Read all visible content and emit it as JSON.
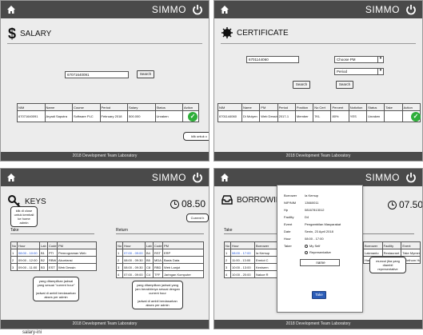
{
  "app": {
    "brand": "SIMMO",
    "footer": "2018 Development Team Laboratory"
  },
  "salary": {
    "title": "SALARY",
    "search_value": "67071640091",
    "search_button": "Search",
    "columns": [
      "NIM",
      "Name",
      "Course",
      "Period",
      "Salary",
      "Status",
      "Action"
    ],
    "row": [
      "67071640091",
      "Aryadi Saputra",
      "Software PLC",
      "February 2018",
      "500.000",
      "Unraken",
      ""
    ],
    "note": "klik untuk c"
  },
  "certificate": {
    "title": "CERTIFICATE",
    "search_value": "6701144060",
    "select_pm": "Choose PM",
    "select_period": "Period",
    "search_button_1": "Search",
    "search_button_2": "Search",
    "columns": [
      "NIM",
      "Name",
      "PM",
      "Period",
      "Position",
      "No Cert",
      "Percent",
      "Notiction",
      "Status",
      "Take",
      "Action"
    ],
    "row": [
      "6701144060",
      "Di Mulyen",
      "Web Dessin",
      "2017-1",
      "Member",
      "7KL",
      "80%",
      "YES",
      "Unraken",
      "",
      ""
    ]
  },
  "keys": {
    "title": "KEYS",
    "time": "08.50",
    "current_label": "Current h",
    "take_note": "klik di close untuk kembali ke home admin",
    "take_label": "Take",
    "return_label": "Return",
    "take_columns": [
      "No",
      "Hour",
      "Lab",
      "Code",
      "PM"
    ],
    "take_rows": [
      [
        "1",
        "08:00 - 10:00",
        "B1",
        "PTI",
        "Pemrograman Web"
      ],
      [
        "2",
        "09:00 - 12:00",
        "B2",
        "RBW",
        "Akuntansi"
      ],
      [
        "3",
        "09:00 - 11:00",
        "B3",
        "EST",
        "Web Dessin"
      ]
    ],
    "return_columns": [
      "No",
      "Hour",
      "Lab",
      "Code",
      "PM"
    ],
    "return_rows": [
      [
        "1",
        "07:00 - 09:00",
        "B4",
        "RST",
        "ERP"
      ],
      [
        "2",
        "08:00 - 09:30",
        "B5",
        "MDA",
        "Basis Data"
      ],
      [
        "3",
        "08:00 - 09:30",
        "C8",
        "RBD",
        "Web Lanjut"
      ],
      [
        "4",
        "07:00 - 09:00",
        "C4",
        "TFF",
        "Jaringan Komputer"
      ]
    ],
    "take_note_bottom": "yang ditampilkan jadwal yang sesuai \"current hour\"\n\njadwal di ambil berdasarkan akses per admin",
    "return_note_bottom": "yang ditampilkan jadwal yang jam berakhirnya sesuai dengan current hour\n\njadwal di ambil berdasarkan akses per admin"
  },
  "borrowing": {
    "title": "BORROWIN",
    "time": "07.50",
    "take_label": "Take",
    "columns_left": [
      "No",
      "Hour",
      "Borrower"
    ],
    "rows_left": [
      [
        "1",
        "08:00 - 17:00",
        "Ia Kemup"
      ],
      [
        "2",
        "11:00 - 13:00",
        "Ermiot C"
      ],
      [
        "3",
        "10:00 - 13:00",
        "Kenisem"
      ],
      [
        "4",
        "10:00 - 20:00",
        "Nakoe R"
      ]
    ],
    "columns_right": [
      "Borrower",
      "Facility",
      "Event"
    ],
    "rows_right": [
      [
        "Lakmanto",
        "Restaurant",
        "Take Mymer"
      ],
      [
        "Hardy S",
        "Gallery",
        "Pelethom Hotel"
      ]
    ],
    "modal": {
      "fields": [
        [
          "Borrower",
          "Ia Kemup"
        ],
        [
          "NIP/NIM",
          "13660011"
        ],
        [
          "Hp",
          "08167813012"
        ],
        [
          "Facility",
          "D4"
        ],
        [
          "Event",
          "Pengambilan Masyarakat"
        ],
        [
          "Date",
          "Senin, 23 April 2018"
        ],
        [
          "Hour",
          "08:00 - 17:00"
        ]
      ],
      "taker_label": "Taker",
      "option_self": "My Self",
      "option_rep": "Representative",
      "name_placeholder": "name",
      "take_button": "Take",
      "note": "muncul jika yang diambil representative"
    }
  },
  "caption": "salary-ini"
}
